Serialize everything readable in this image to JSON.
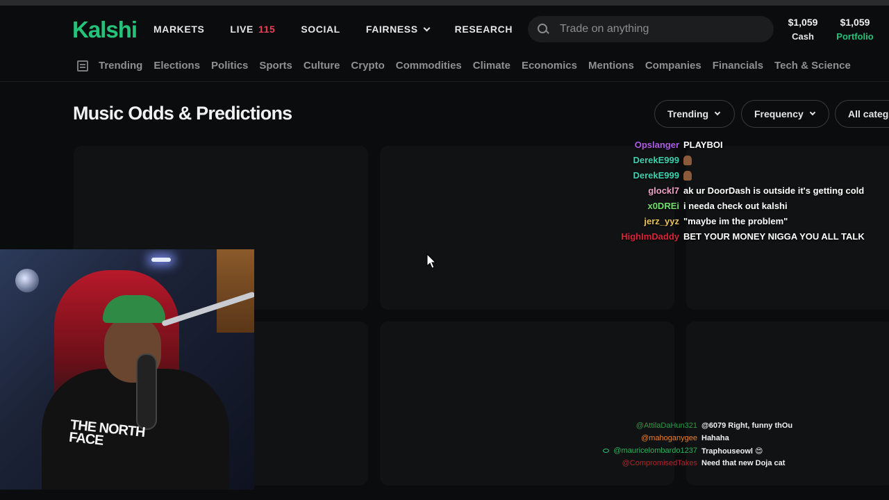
{
  "header": {
    "logo": "Kalshi",
    "nav": [
      {
        "label": "MARKETS"
      },
      {
        "label": "LIVE",
        "count": "115"
      },
      {
        "label": "SOCIAL"
      },
      {
        "label": "FAIRNESS"
      },
      {
        "label": "RESEARCH"
      }
    ],
    "search_placeholder": "Trade on anything",
    "cash": {
      "amount": "$1,059",
      "label": "Cash"
    },
    "portfolio": {
      "amount": "$1,059",
      "label": "Portfolio"
    }
  },
  "categories": [
    "Trending",
    "Elections",
    "Politics",
    "Sports",
    "Culture",
    "Crypto",
    "Commodities",
    "Climate",
    "Economics",
    "Mentions",
    "Companies",
    "Financials",
    "Tech & Science"
  ],
  "page": {
    "title": "Music Odds & Predictions",
    "filters": [
      "Trending",
      "Frequency",
      "All categ"
    ]
  },
  "chat": [
    {
      "user": "Opslanger",
      "color": "#b05ce8",
      "msg": "PLAYBOI"
    },
    {
      "user": "DerekE999",
      "color": "#3ed1b0",
      "msg": "",
      "emote": true
    },
    {
      "user": "DerekE999",
      "color": "#3ed1b0",
      "msg": "",
      "emote": true
    },
    {
      "user": "glockl7",
      "color": "#f0a0c8",
      "msg": "ak ur DoorDash is outside it's getting cold"
    },
    {
      "user": "x0DREi",
      "color": "#6fe06a",
      "msg": "i needa check out kalshi"
    },
    {
      "user": "jerz_yyz",
      "color": "#e6c25a",
      "msg": "\"maybe im the problem\""
    },
    {
      "user": "HighImDaddy",
      "color": "#d8243a",
      "msg": "BET YOUR MONEY NIGGA YOU ALL TALK"
    }
  ],
  "chat_secondary": [
    {
      "user": "@AttilaDaHun321",
      "color": "#2f9a4a",
      "msg": "@6079 Right, funny thOu"
    },
    {
      "user": "@mahoganygee",
      "color": "#e8822e",
      "msg": "Hahaha"
    },
    {
      "user": "@mauricelombardo1237",
      "color": "#2fb45a",
      "msg": "Traphouseowl 😍",
      "badge": true
    },
    {
      "user": "@CompromisedTakes",
      "color": "#b8232e",
      "msg": "Need that new Doja cat"
    }
  ],
  "webcam": {
    "shirt_text": "THE NORTH FACE"
  }
}
